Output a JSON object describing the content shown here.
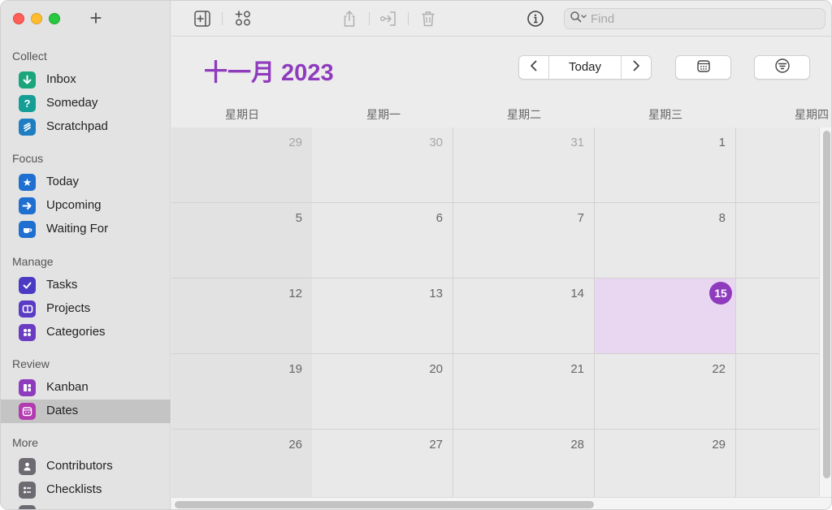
{
  "sidebar": {
    "sections": [
      {
        "label": "Collect"
      },
      {
        "label": "Focus"
      },
      {
        "label": "Manage"
      },
      {
        "label": "Review"
      },
      {
        "label": "More"
      }
    ],
    "items": [
      {
        "label": "Inbox",
        "icon": "inbox-icon",
        "color": "#1aa57b"
      },
      {
        "label": "Someday",
        "icon": "question-icon",
        "color": "#159e96"
      },
      {
        "label": "Scratchpad",
        "icon": "scratchpad-icon",
        "color": "#1f7ec2"
      },
      {
        "label": "Today",
        "icon": "star-icon",
        "color": "#1f6fd1"
      },
      {
        "label": "Upcoming",
        "icon": "arrow-right-icon",
        "color": "#1f6fd1"
      },
      {
        "label": "Waiting For",
        "icon": "cup-icon",
        "color": "#1f6fd1"
      },
      {
        "label": "Tasks",
        "icon": "checkmark-icon",
        "color": "#4b3bc4"
      },
      {
        "label": "Projects",
        "icon": "projects-icon",
        "color": "#5a3bc4"
      },
      {
        "label": "Categories",
        "icon": "categories-icon",
        "color": "#6b3bc4"
      },
      {
        "label": "Kanban",
        "icon": "kanban-icon",
        "color": "#8e3bbd"
      },
      {
        "label": "Dates",
        "icon": "calendar-icon",
        "color": "#b23bb0",
        "selected": true
      },
      {
        "label": "Contributors",
        "icon": "person-icon",
        "color": "#6e6a72"
      },
      {
        "label": "Checklists",
        "icon": "checklist-icon",
        "color": "#6e6a72"
      }
    ]
  },
  "toolbar": {
    "search_placeholder": "Find"
  },
  "calendar": {
    "month_title": "十一月 2023",
    "today_label": "Today",
    "weekdays": [
      "星期日",
      "星期一",
      "星期二",
      "星期三",
      "星期四"
    ],
    "weeks": [
      [
        "29",
        "30",
        "31",
        "1",
        ""
      ],
      [
        "5",
        "6",
        "7",
        "8",
        ""
      ],
      [
        "12",
        "13",
        "14",
        "15",
        ""
      ],
      [
        "19",
        "20",
        "21",
        "22",
        ""
      ],
      [
        "26",
        "27",
        "28",
        "29",
        ""
      ]
    ],
    "today": "15",
    "accent_color": "#8e3bbd"
  }
}
